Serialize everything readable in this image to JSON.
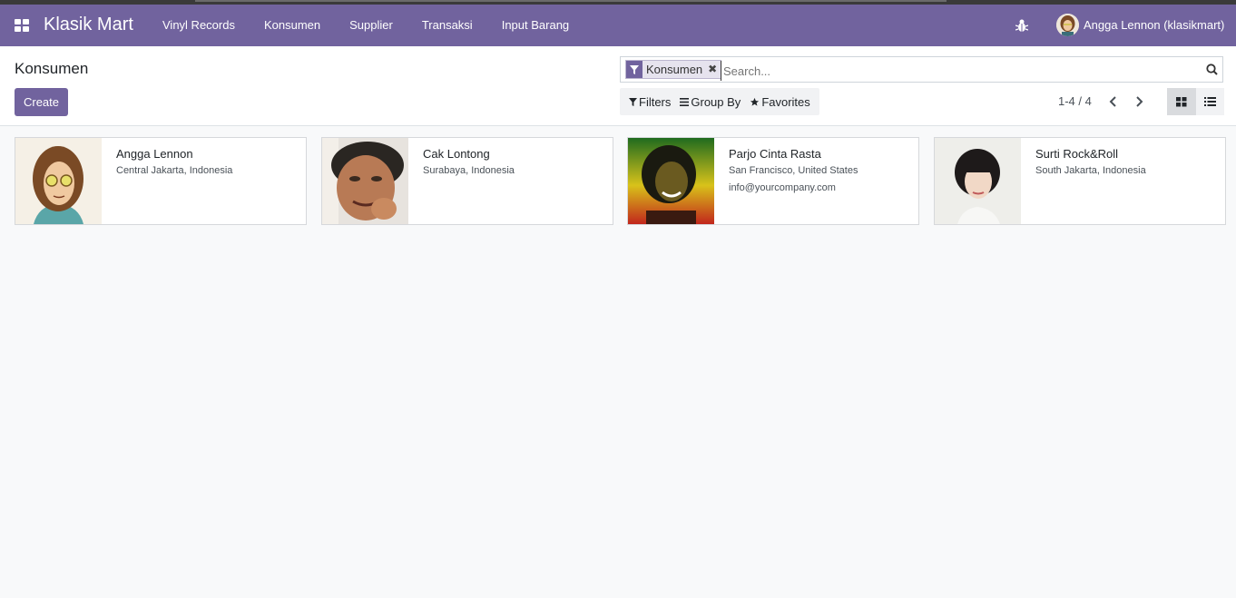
{
  "navbar": {
    "brand": "Klasik Mart",
    "menu": [
      "Vinyl Records",
      "Konsumen",
      "Supplier",
      "Transaksi",
      "Input Barang"
    ],
    "user_name": "Angga Lennon (klasikmart)"
  },
  "control": {
    "title": "Konsumen",
    "create_label": "Create",
    "search": {
      "facet_label": "Konsumen",
      "placeholder": "Search..."
    },
    "filters_label": "Filters",
    "groupby_label": "Group By",
    "favorites_label": "Favorites",
    "pager": "1-4 / 4"
  },
  "cards": [
    {
      "name": "Angga Lennon",
      "address": "Central Jakarta, Indonesia",
      "email": ""
    },
    {
      "name": "Cak Lontong",
      "address": "Surabaya, Indonesia",
      "email": ""
    },
    {
      "name": "Parjo Cinta Rasta",
      "address": "San Francisco, United States",
      "email": "info@yourcompany.com"
    },
    {
      "name": "Surti Rock&Roll",
      "address": "South Jakarta, Indonesia",
      "email": ""
    }
  ],
  "colors": {
    "brand": "#71639e",
    "background": "#f8f9fa"
  },
  "icons": [
    "apps-grid-icon",
    "bug-icon",
    "filter-icon",
    "close-icon",
    "search-icon",
    "bars-icon",
    "star-icon",
    "chevron-left-icon",
    "chevron-right-icon",
    "kanban-view-icon",
    "list-view-icon"
  ]
}
